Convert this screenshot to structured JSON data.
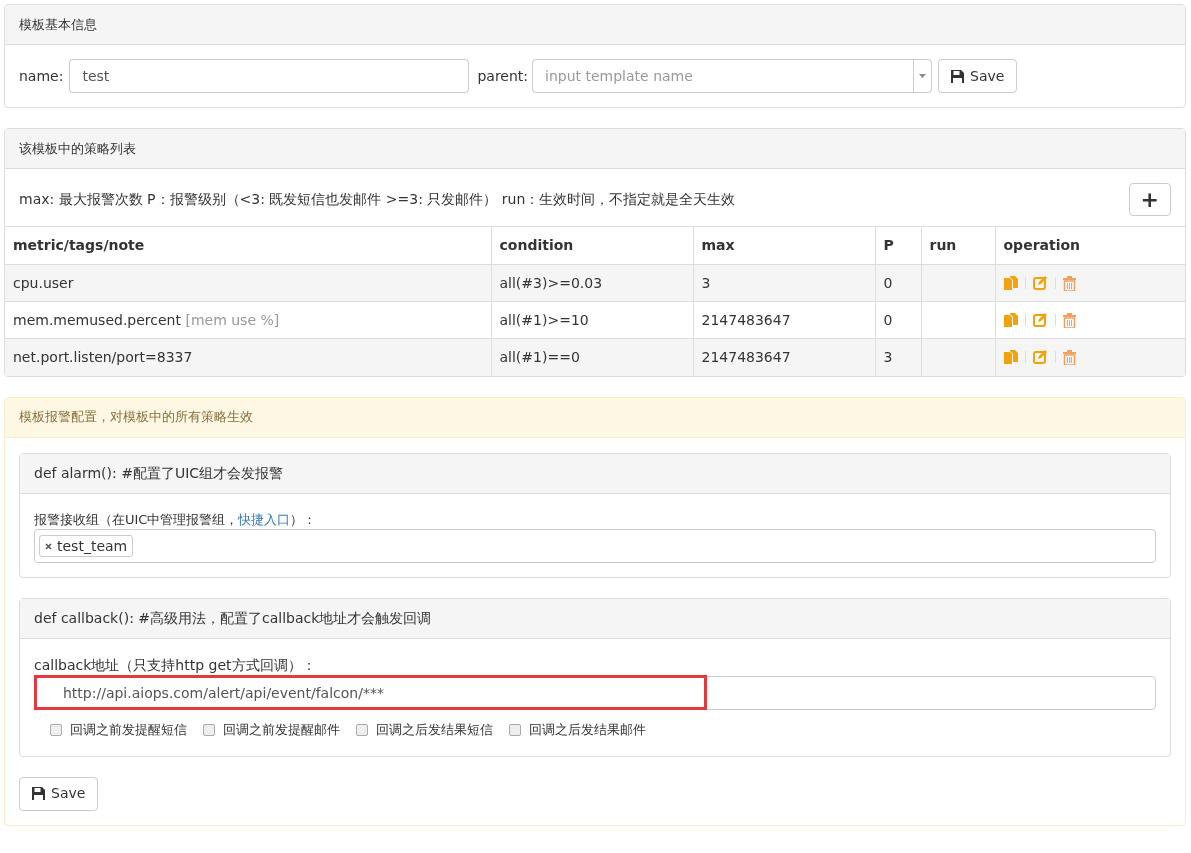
{
  "template_panel": {
    "title": "模板基本信息",
    "name_label": "name:",
    "name_value": "test",
    "parent_label": "parent:",
    "parent_placeholder": "input template name",
    "save_button": "Save"
  },
  "strategy_panel": {
    "title": "该模板中的策略列表",
    "legend": "max: 最大报警次数 P：报警级别（<3: 既发短信也发邮件 >=3: 只发邮件） run：生效时间，不指定就是全天生效",
    "add_button": "+",
    "table": {
      "columns": [
        "metric/tags/note",
        "condition",
        "max",
        "P",
        "run",
        "operation"
      ],
      "rows": [
        {
          "metric": "cpu.user",
          "condition": "all(#3)>=0.03",
          "max": "3",
          "p": "0"
        },
        {
          "metric": "mem.memused.percent",
          "note": "[mem use %]",
          "condition": "all(#1)>=10",
          "max": "2147483647",
          "p": "0"
        },
        {
          "metric": "net.port.listen/port=8337",
          "condition": "all(#1)==0",
          "max": "2147483647",
          "p": "3"
        }
      ]
    }
  },
  "alarm_panel": {
    "title": "模板报警配置，对模板中的所有策略生效",
    "alarm": {
      "title": "def alarm(): #配置了UIC组才会发报警",
      "label": "报警接收组（在UIC中管理报警组，",
      "link": "快捷入口",
      "label_end": "）：",
      "tags": [
        "test_team"
      ]
    },
    "callback": {
      "title": "def callback(): #高级用法，配置了callback地址才会触发回调",
      "label": "callback地址（只支持http get方式回调）：",
      "url": "http://api.aiops.com/alert/api/event/falcon/***",
      "highlighted": true,
      "options": [
        {
          "label": "回调之前发提醒短信",
          "checked": false
        },
        {
          "label": "回调之前发提醒邮件",
          "checked": false
        },
        {
          "label": "回调之后发结果短信",
          "checked": false
        },
        {
          "label": "回调之后发结果邮件",
          "checked": false
        }
      ]
    },
    "save_button": "Save"
  }
}
